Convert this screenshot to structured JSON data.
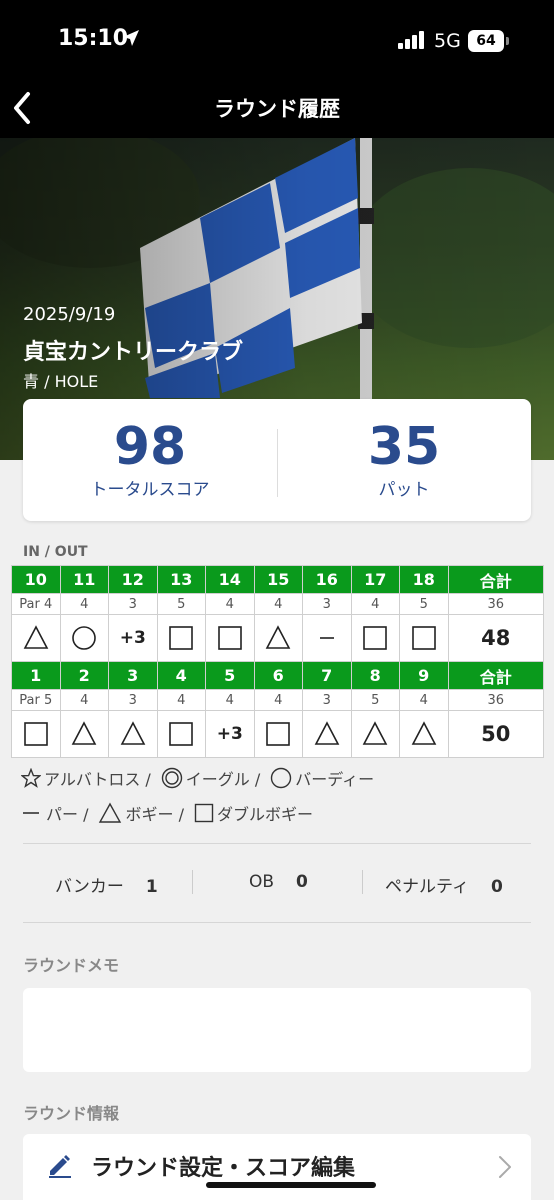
{
  "status_bar": {
    "time": "15:10",
    "network": "5G",
    "battery": "64"
  },
  "header": {
    "title": "ラウンド履歴"
  },
  "hero": {
    "date": "2025/9/19",
    "course": "貞宝カントリークラブ",
    "tee": "青  / HOLE"
  },
  "summary": {
    "total_score": "98",
    "total_label": "トータルスコア",
    "putts": "35",
    "putts_label": "パット"
  },
  "scorecard": {
    "label": "IN / OUT",
    "in": {
      "holes": [
        "10",
        "11",
        "12",
        "13",
        "14",
        "15",
        "16",
        "17",
        "18"
      ],
      "total_label": "合計",
      "pars": [
        "Par 4",
        "4",
        "3",
        "5",
        "4",
        "4",
        "3",
        "4",
        "5"
      ],
      "par_total": "36",
      "results": [
        "bogey",
        "birdie",
        "+3",
        "double",
        "double",
        "bogey",
        "par",
        "double",
        "double"
      ],
      "total": "48"
    },
    "out": {
      "holes": [
        "1",
        "2",
        "3",
        "4",
        "5",
        "6",
        "7",
        "8",
        "9"
      ],
      "total_label": "合計",
      "pars": [
        "Par 5",
        "4",
        "3",
        "4",
        "4",
        "4",
        "3",
        "5",
        "4"
      ],
      "par_total": "36",
      "results": [
        "double",
        "bogey",
        "bogey",
        "double",
        "+3",
        "double",
        "bogey",
        "bogey",
        "bogey"
      ],
      "total": "50"
    }
  },
  "legend": {
    "albatross": "アルバトロス /",
    "eagle": "イーグル /",
    "birdie": "バーディー",
    "par": "パー /",
    "bogey": "ボギー /",
    "double": "ダブルボギー"
  },
  "stats": {
    "bunker_label": "バンカー",
    "bunker_value": "1",
    "ob_label": "OB",
    "ob_value": "0",
    "penalty_label": "ペナルティ",
    "penalty_value": "0"
  },
  "memo": {
    "label": "ラウンドメモ"
  },
  "info": {
    "label": "ラウンド情報",
    "edit_label": "ラウンド設定・スコア編集"
  },
  "colors": {
    "header_bg": "#000000",
    "hole_green": "#0a9a1c",
    "score_blue": "#2a4b8d"
  }
}
